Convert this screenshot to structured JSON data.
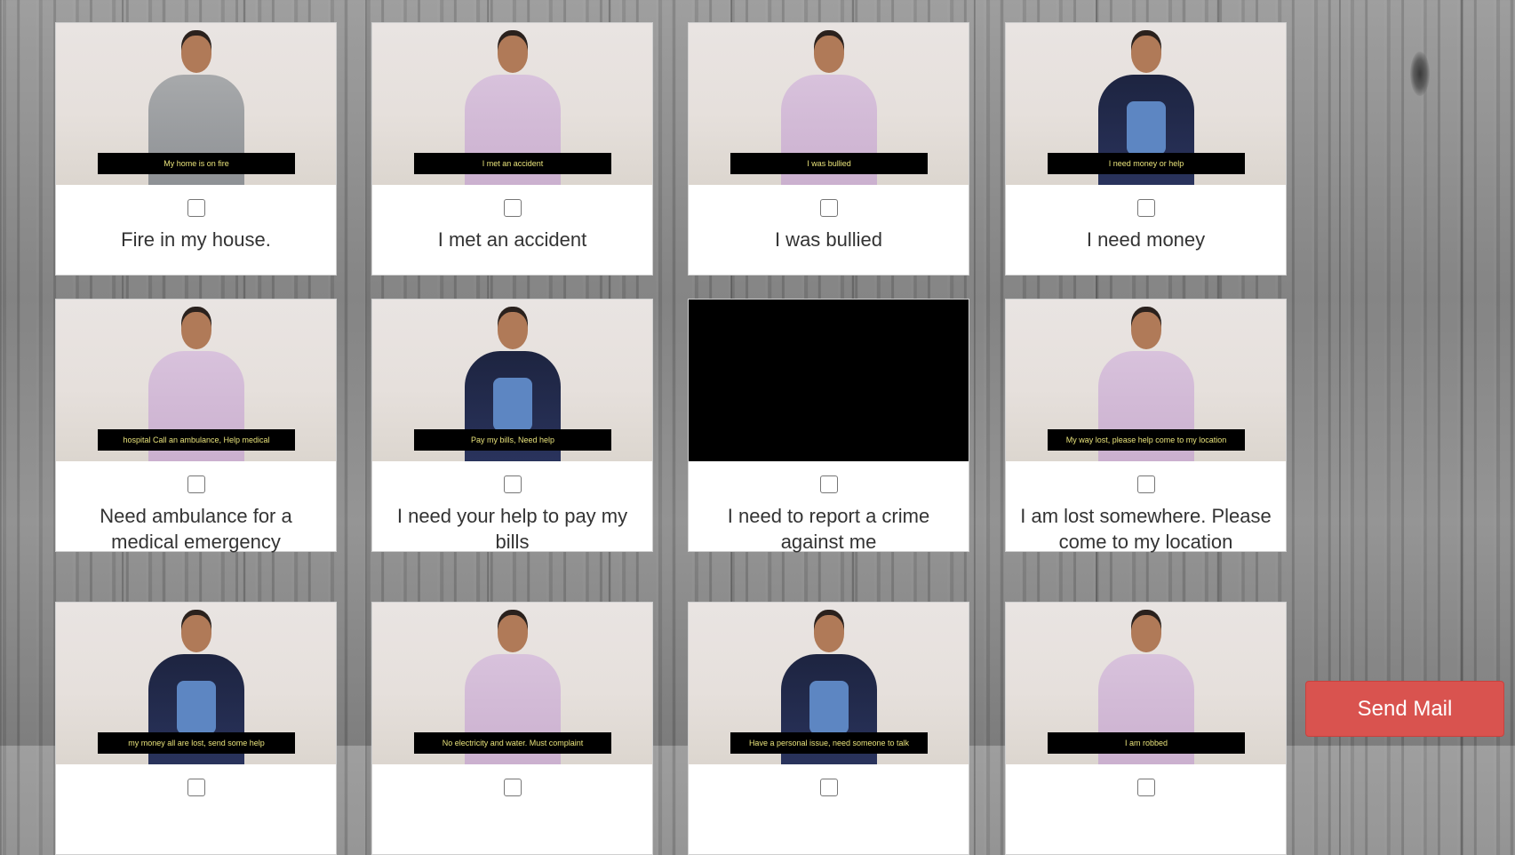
{
  "cards": [
    {
      "caption": "My home is on fire",
      "label": "Fire in my house.",
      "torso": "grey",
      "checked": false
    },
    {
      "caption": "I met an accident",
      "label": "I met an accident",
      "torso": "lilac",
      "checked": false
    },
    {
      "caption": "I was bullied",
      "label": "I was bullied",
      "torso": "lilac",
      "checked": false
    },
    {
      "caption": "I need money or help",
      "label": "I need money",
      "torso": "navy",
      "checked": false
    },
    {
      "caption": "hospital  Call an ambulance, Help medical",
      "label": "Need ambulance for a medical emergency",
      "torso": "lilac",
      "checked": false
    },
    {
      "caption": "Pay my bills, Need help",
      "label": "I need your help to pay my bills",
      "torso": "navy",
      "checked": false
    },
    {
      "caption": "",
      "label": "I need to report a crime against me",
      "torso": "none",
      "checked": false
    },
    {
      "caption": "My way lost, please help come to my location",
      "label": "I am lost somewhere. Please come to my location",
      "torso": "lilac",
      "checked": false
    },
    {
      "caption": "my money all are lost, send some help",
      "label": "",
      "torso": "navy",
      "checked": false
    },
    {
      "caption": "No electricity and water. Must complaint",
      "label": "",
      "torso": "lilac",
      "checked": false
    },
    {
      "caption": "Have a personal issue, need someone to talk",
      "label": "",
      "torso": "navy",
      "checked": false
    },
    {
      "caption": "I am robbed",
      "label": "",
      "torso": "lilac",
      "checked": false
    }
  ],
  "send_button": {
    "label": "Send Mail"
  },
  "colors": {
    "send_button": "#d9534f",
    "caption_text": "#e8e27a",
    "card_bg": "#ffffff"
  }
}
